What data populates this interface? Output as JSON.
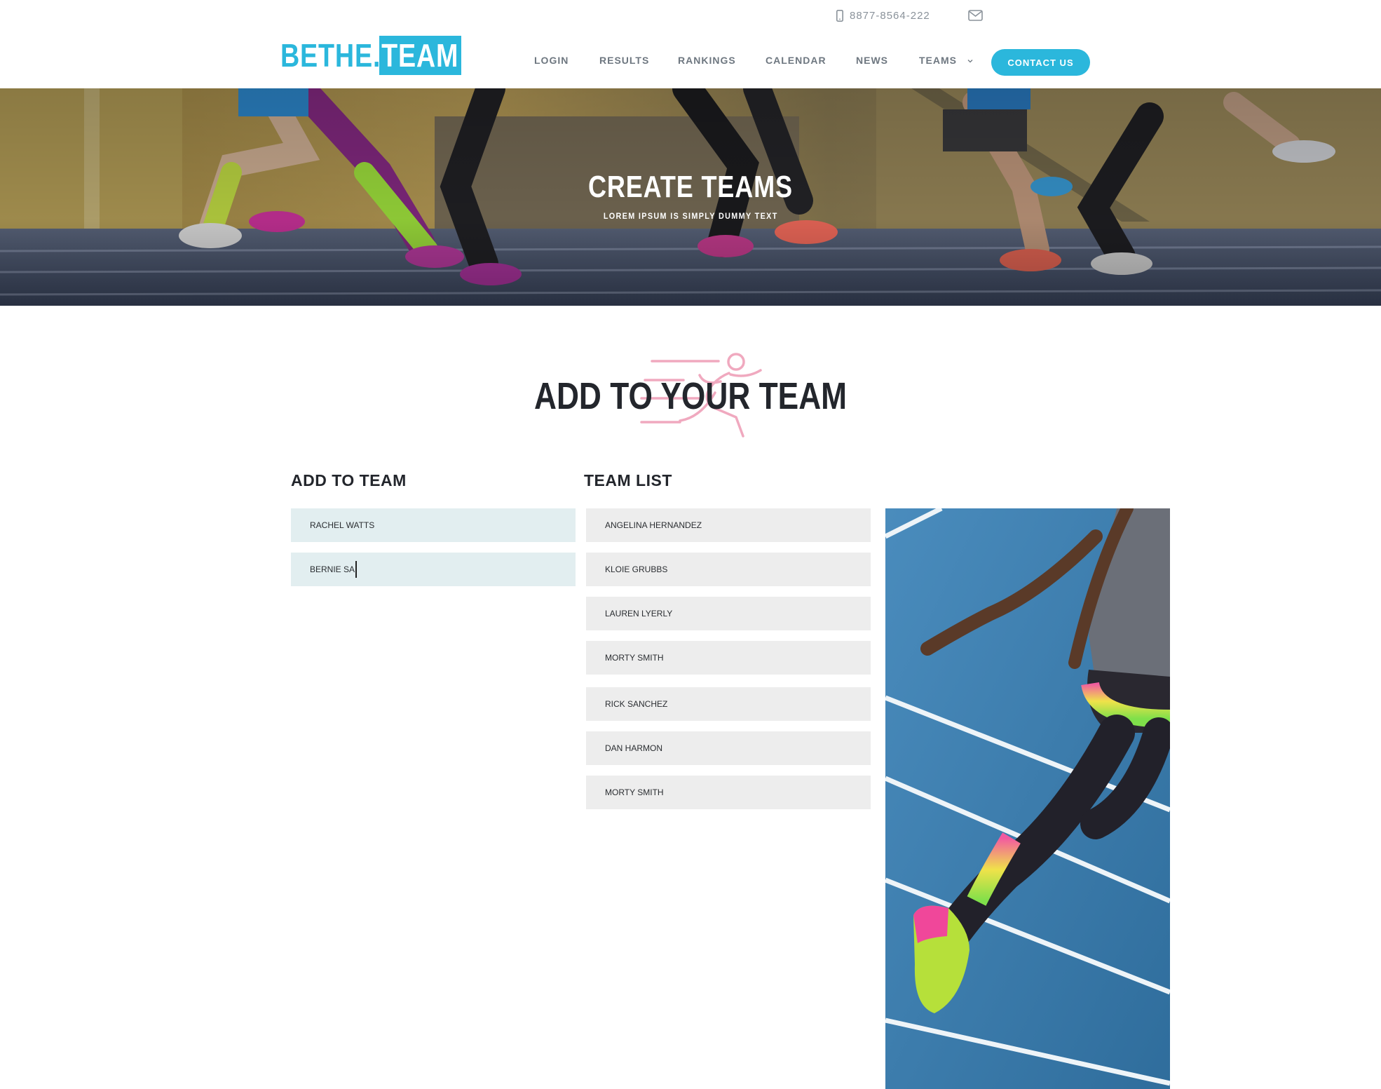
{
  "header": {
    "phone": "8877-8564-222",
    "logo_part1": "BETHE.",
    "logo_part2": "TEAM",
    "nav": [
      "LOGIN",
      "RESULTS",
      "RANKINGS",
      "CALENDAR",
      "NEWS",
      "TEAMS"
    ],
    "contact_label": "CONTACT US",
    "accent": "#2bb7dc"
  },
  "hero": {
    "title": "CREATE TEAMS",
    "subtitle": "LOREM IPSUM IS SIMPLY DUMMY TEXT"
  },
  "section": {
    "title": "ADD TO YOUR TEAM"
  },
  "add_to_team": {
    "heading": "ADD TO TEAM",
    "entries": [
      "RACHEL WATTS",
      "BERNIE SA"
    ]
  },
  "team_list": {
    "heading": "TEAM LIST",
    "members": [
      "ANGELINA HERNANDEZ",
      "KLOIE GRUBBS",
      "LAUREN LYERLY",
      "MORTY SMITH",
      "RICK SANCHEZ",
      "DAN HARMON",
      "MORTY SMITH"
    ]
  }
}
